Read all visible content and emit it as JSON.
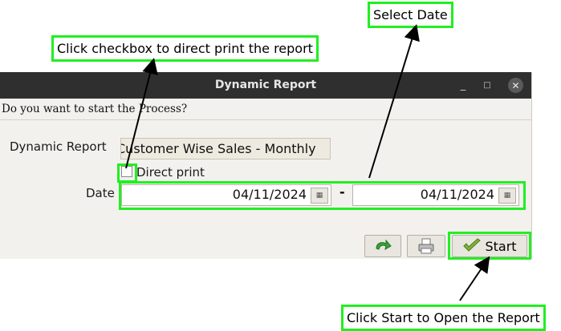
{
  "window": {
    "title": "Dynamic Report",
    "minimize_glyph": "_",
    "maximize_glyph": "□",
    "close_glyph": "✕"
  },
  "question": "Do you want to start the Process?",
  "form": {
    "report_label": "Dynamic Report",
    "report_value": "Customer Wise Sales - Monthly",
    "direct_print_label": "Direct print",
    "direct_print_checked": false,
    "date_label": "Date",
    "date_from": "04/11/2024",
    "date_separator": "-",
    "date_to": "04/11/2024"
  },
  "toolbar": {
    "refresh_icon": "green-refresh-arrow-icon",
    "print_icon": "printer-icon",
    "start_icon": "checkmark-icon",
    "start_label": "Start"
  },
  "annotations": {
    "checkbox_hint": "Click checkbox to direct print the report",
    "date_hint": "Select Date",
    "start_hint": "Click Start to Open the Report"
  },
  "colors": {
    "highlight": "#22ee22",
    "titlebar": "#2f2f2f",
    "dialog_bg": "#f2f1ee"
  }
}
